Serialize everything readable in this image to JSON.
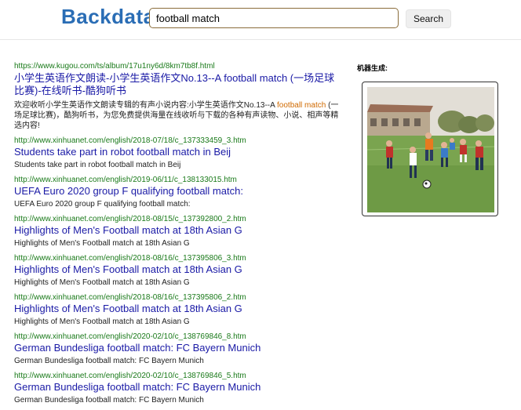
{
  "header": {
    "logo": "Backdata",
    "search_value": "football match",
    "search_button": "Search"
  },
  "results": [
    {
      "url": "https://www.kugou.com/ts/album/17u1ny6d/8km7tb8f.html",
      "title": "小学生英语作文朗读-小学生英语作文No.13--A football match (一场足球比赛)-在线听书-酷狗听书",
      "snippet_before": "欢迎收听小学生英语作文朗读专辑的有声小说内容:小学生英语作文No.13--A ",
      "snippet_highlight": "football match",
      "snippet_after": " (一场足球比赛)，酷狗听书，为您免费提供海量在线收听与下载的各种有声读物、小说、相声等精选内容!"
    },
    {
      "url": "http://www.xinhuanet.com/english/2018-07/18/c_137333459_3.htm",
      "title": "Students take part in robot football match in Beij",
      "snippet": "Students take part in robot football match in Beij"
    },
    {
      "url": "http://www.xinhuanet.com/english/2019-06/11/c_138133015.htm",
      "title": "UEFA Euro 2020 group F qualifying football match:",
      "snippet": "UEFA Euro 2020 group F qualifying football match:"
    },
    {
      "url": "http://www.xinhuanet.com/english/2018-08/15/c_137392800_2.htm",
      "title": "Highlights of Men's Football match at 18th Asian G",
      "snippet": "Highlights of Men's Football match at 18th Asian G"
    },
    {
      "url": "http://www.xinhuanet.com/english/2018-08/16/c_137395806_3.htm",
      "title": "Highlights of Men's Football match at 18th Asian G",
      "snippet": "Highlights of Men's Football match at 18th Asian G"
    },
    {
      "url": "http://www.xinhuanet.com/english/2018-08/16/c_137395806_2.htm",
      "title": "Highlights of Men's Football match at 18th Asian G",
      "snippet": "Highlights of Men's Football match at 18th Asian G"
    },
    {
      "url": "http://www.xinhuanet.com/english/2020-02/10/c_138769846_8.htm",
      "title": "German Bundesliga football match: FC Bayern Munich",
      "snippet": "German Bundesliga football match: FC Bayern Munich"
    },
    {
      "url": "http://www.xinhuanet.com/english/2020-02/10/c_138769846_5.htm",
      "title": "German Bundesliga football match: FC Bayern Munich",
      "snippet": "German Bundesliga football match: FC Bayern Munich"
    }
  ],
  "sidebar": {
    "label": "机器生成:",
    "image_icon": "football-match-painting"
  },
  "colors": {
    "logo": "#2a6db5",
    "url": "#1a7a1a",
    "title": "#1a1aa6",
    "highlight": "#d06a00"
  }
}
